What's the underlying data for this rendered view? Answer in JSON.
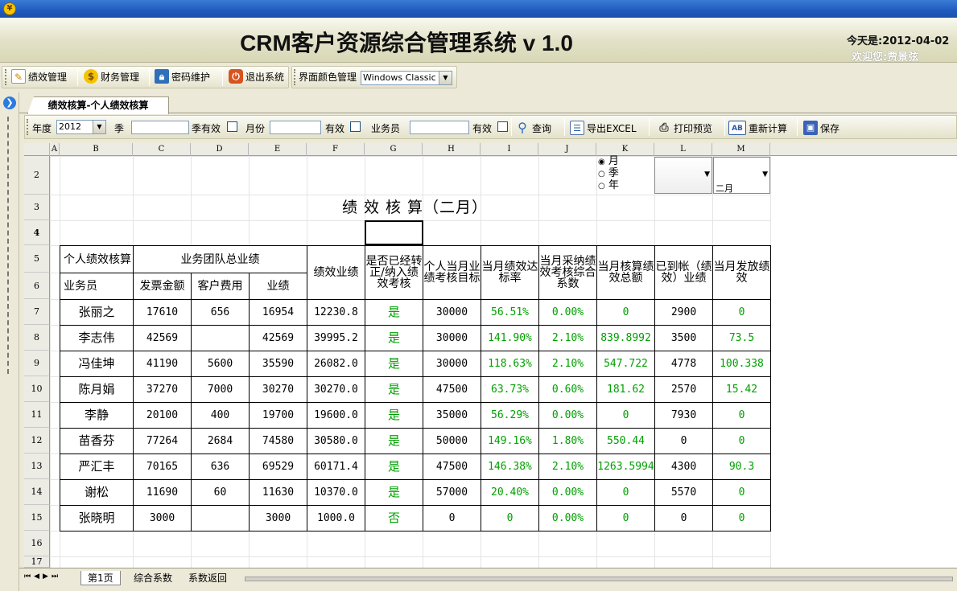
{
  "app": {
    "title": "CRM客户资源综合管理系统 v 1.0",
    "today": "今天是:2012-04-02",
    "welcome": "欢迎您:贾景弦"
  },
  "menu": {
    "items": [
      "绩效管理",
      "财务管理",
      "密码维护",
      "退出系统"
    ],
    "theme_label": "界面颜色管理",
    "theme_value": "Windows Classic"
  },
  "tab": {
    "active": "绩效核算-个人绩效核算"
  },
  "filters": {
    "year_label": "年度",
    "year_value": "2012",
    "quarter_label": "季",
    "quarter_valid_label": "季有效",
    "month_label": "月份",
    "month_valid_label": "有效",
    "salesman_label": "业务员",
    "salesman_valid_label": "有效",
    "buttons": [
      "查询",
      "导出EXCEL",
      "打印预览",
      "重新计算",
      "保存"
    ]
  },
  "sheet": {
    "columns": [
      "A",
      "B",
      "C",
      "D",
      "E",
      "F",
      "G",
      "H",
      "I",
      "J",
      "K",
      "L",
      "M"
    ],
    "rows_shown": [
      "2",
      "3",
      "4",
      "5",
      "6",
      "7",
      "8",
      "9",
      "10",
      "11",
      "12",
      "13",
      "14",
      "15",
      "16",
      "17"
    ],
    "period_options": [
      "月",
      "季",
      "年"
    ],
    "month_dropdown": "二月",
    "report_title": "绩 效 核 算（二月）",
    "headers": {
      "personal": "个人绩效核算",
      "team": "业务团队总业绩",
      "salesman": "业务员",
      "invoice": "发票金额",
      "client_fee": "客户费用",
      "performance": "业绩",
      "perf_score": "绩效业绩",
      "regularized": "是否已经转正/纳入绩效考核",
      "target": "个人当月业绩考核目标",
      "rate": "当月绩效达标率",
      "coef": "当月采纳绩效考核综合系数",
      "total": "当月核算绩效总额",
      "received": "已到帐（绩效）业绩",
      "paid": "当月发放绩效"
    },
    "data": [
      [
        "张丽之",
        "17610",
        "656",
        "16954",
        "12230.8",
        "是",
        "30000",
        "56.51%",
        "0.00%",
        "0",
        "2900",
        "0"
      ],
      [
        "李志伟",
        "42569",
        "",
        "42569",
        "39995.2",
        "是",
        "30000",
        "141.90%",
        "2.10%",
        "839.8992",
        "3500",
        "73.5"
      ],
      [
        "冯佳坤",
        "41190",
        "5600",
        "35590",
        "26082.0",
        "是",
        "30000",
        "118.63%",
        "2.10%",
        "547.722",
        "4778",
        "100.338"
      ],
      [
        "陈月娟",
        "37270",
        "7000",
        "30270",
        "30270.0",
        "是",
        "47500",
        "63.73%",
        "0.60%",
        "181.62",
        "2570",
        "15.42"
      ],
      [
        "李静",
        "20100",
        "400",
        "19700",
        "19600.0",
        "是",
        "35000",
        "56.29%",
        "0.00%",
        "0",
        "7930",
        "0"
      ],
      [
        "苗香芬",
        "77264",
        "2684",
        "74580",
        "30580.0",
        "是",
        "50000",
        "149.16%",
        "1.80%",
        "550.44",
        "0",
        "0"
      ],
      [
        "严汇丰",
        "70165",
        "636",
        "69529",
        "60171.4",
        "是",
        "47500",
        "146.38%",
        "2.10%",
        "1263.5994",
        "4300",
        "90.3"
      ],
      [
        "谢松",
        "11690",
        "60",
        "11630",
        "10370.0",
        "是",
        "57000",
        "20.40%",
        "0.00%",
        "0",
        "5570",
        "0"
      ],
      [
        "张晓明",
        "3000",
        "",
        "3000",
        "1000.0",
        "否",
        "0",
        "0",
        "0.00%",
        "0",
        "0",
        "0"
      ]
    ]
  },
  "sheet_tabs": [
    "第1页",
    "综合系数",
    "系数返回"
  ],
  "colors": {
    "highlight": "#00ff00",
    "value_text": "#00a000"
  }
}
